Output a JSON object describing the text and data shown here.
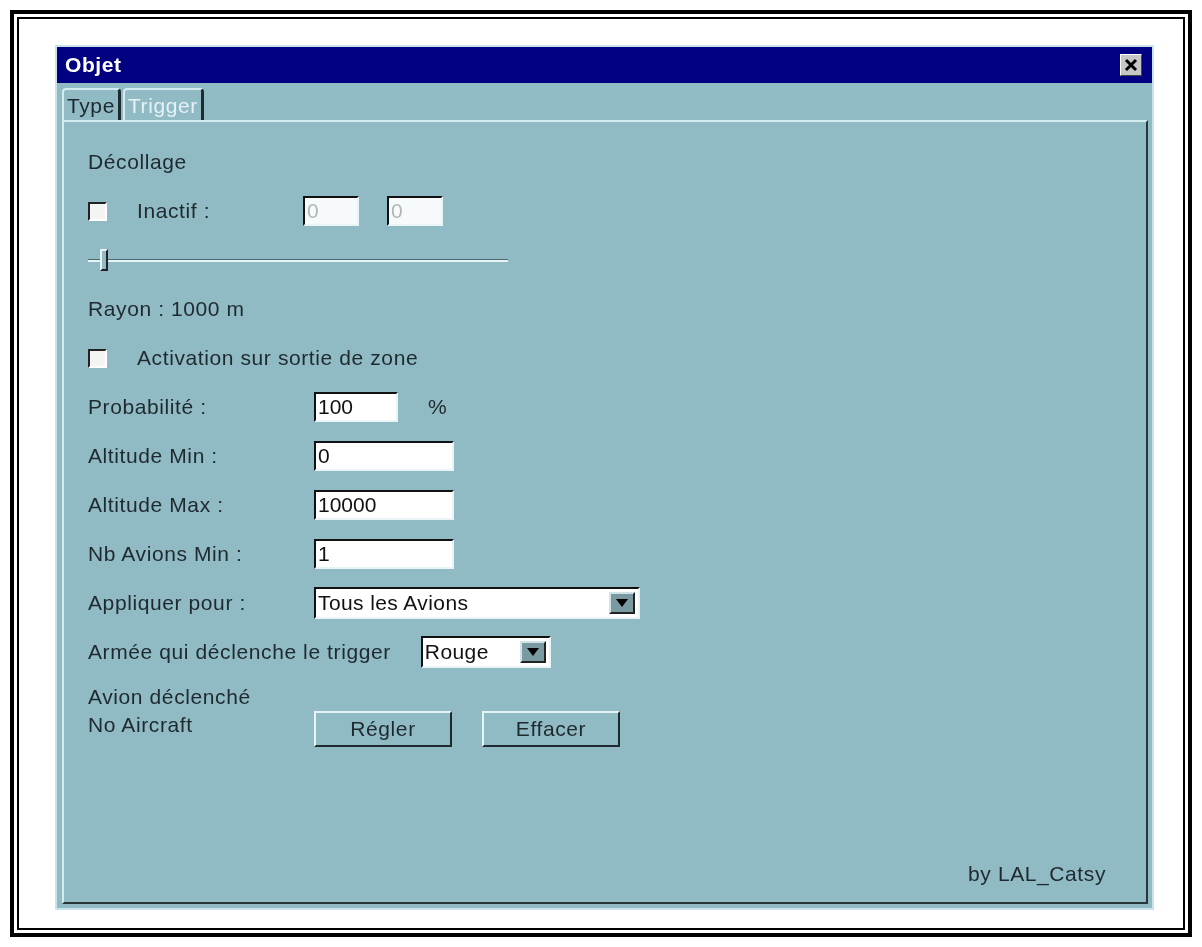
{
  "window": {
    "title": "Objet"
  },
  "tabs": [
    {
      "label": "Type",
      "selected": false
    },
    {
      "label": "Trigger",
      "selected": true
    }
  ],
  "section_title": "Décollage",
  "inactive": {
    "label": "Inactif :",
    "checked": false,
    "disabled": true,
    "values": [
      "0",
      "0"
    ]
  },
  "radius_slider": {
    "level": 0.03
  },
  "radius_label": "Rayon : 1000 m",
  "exit_activation": {
    "label": "Activation sur sortie de zone",
    "checked": false
  },
  "fields": [
    {
      "kind": "text",
      "label": "Probabilité :",
      "value": "100",
      "unit": "%"
    },
    {
      "kind": "text",
      "label": "Altitude Min :",
      "value": "0"
    },
    {
      "kind": "text",
      "label": "Altitude Max :",
      "value": "10000"
    },
    {
      "kind": "text",
      "label": "Nb Avions Min :",
      "value": "1"
    },
    {
      "kind": "select",
      "label": "Appliquer pour :",
      "value": "Tous les Avions"
    },
    {
      "kind": "select",
      "label": "Armée qui déclenche le trigger",
      "value": "Rouge"
    }
  ],
  "aircraft": {
    "label": "Avion déclenché",
    "value": "No Aircraft",
    "buttons": [
      "Régler",
      "Effacer"
    ]
  },
  "footer": "by LAL_Catsy"
}
